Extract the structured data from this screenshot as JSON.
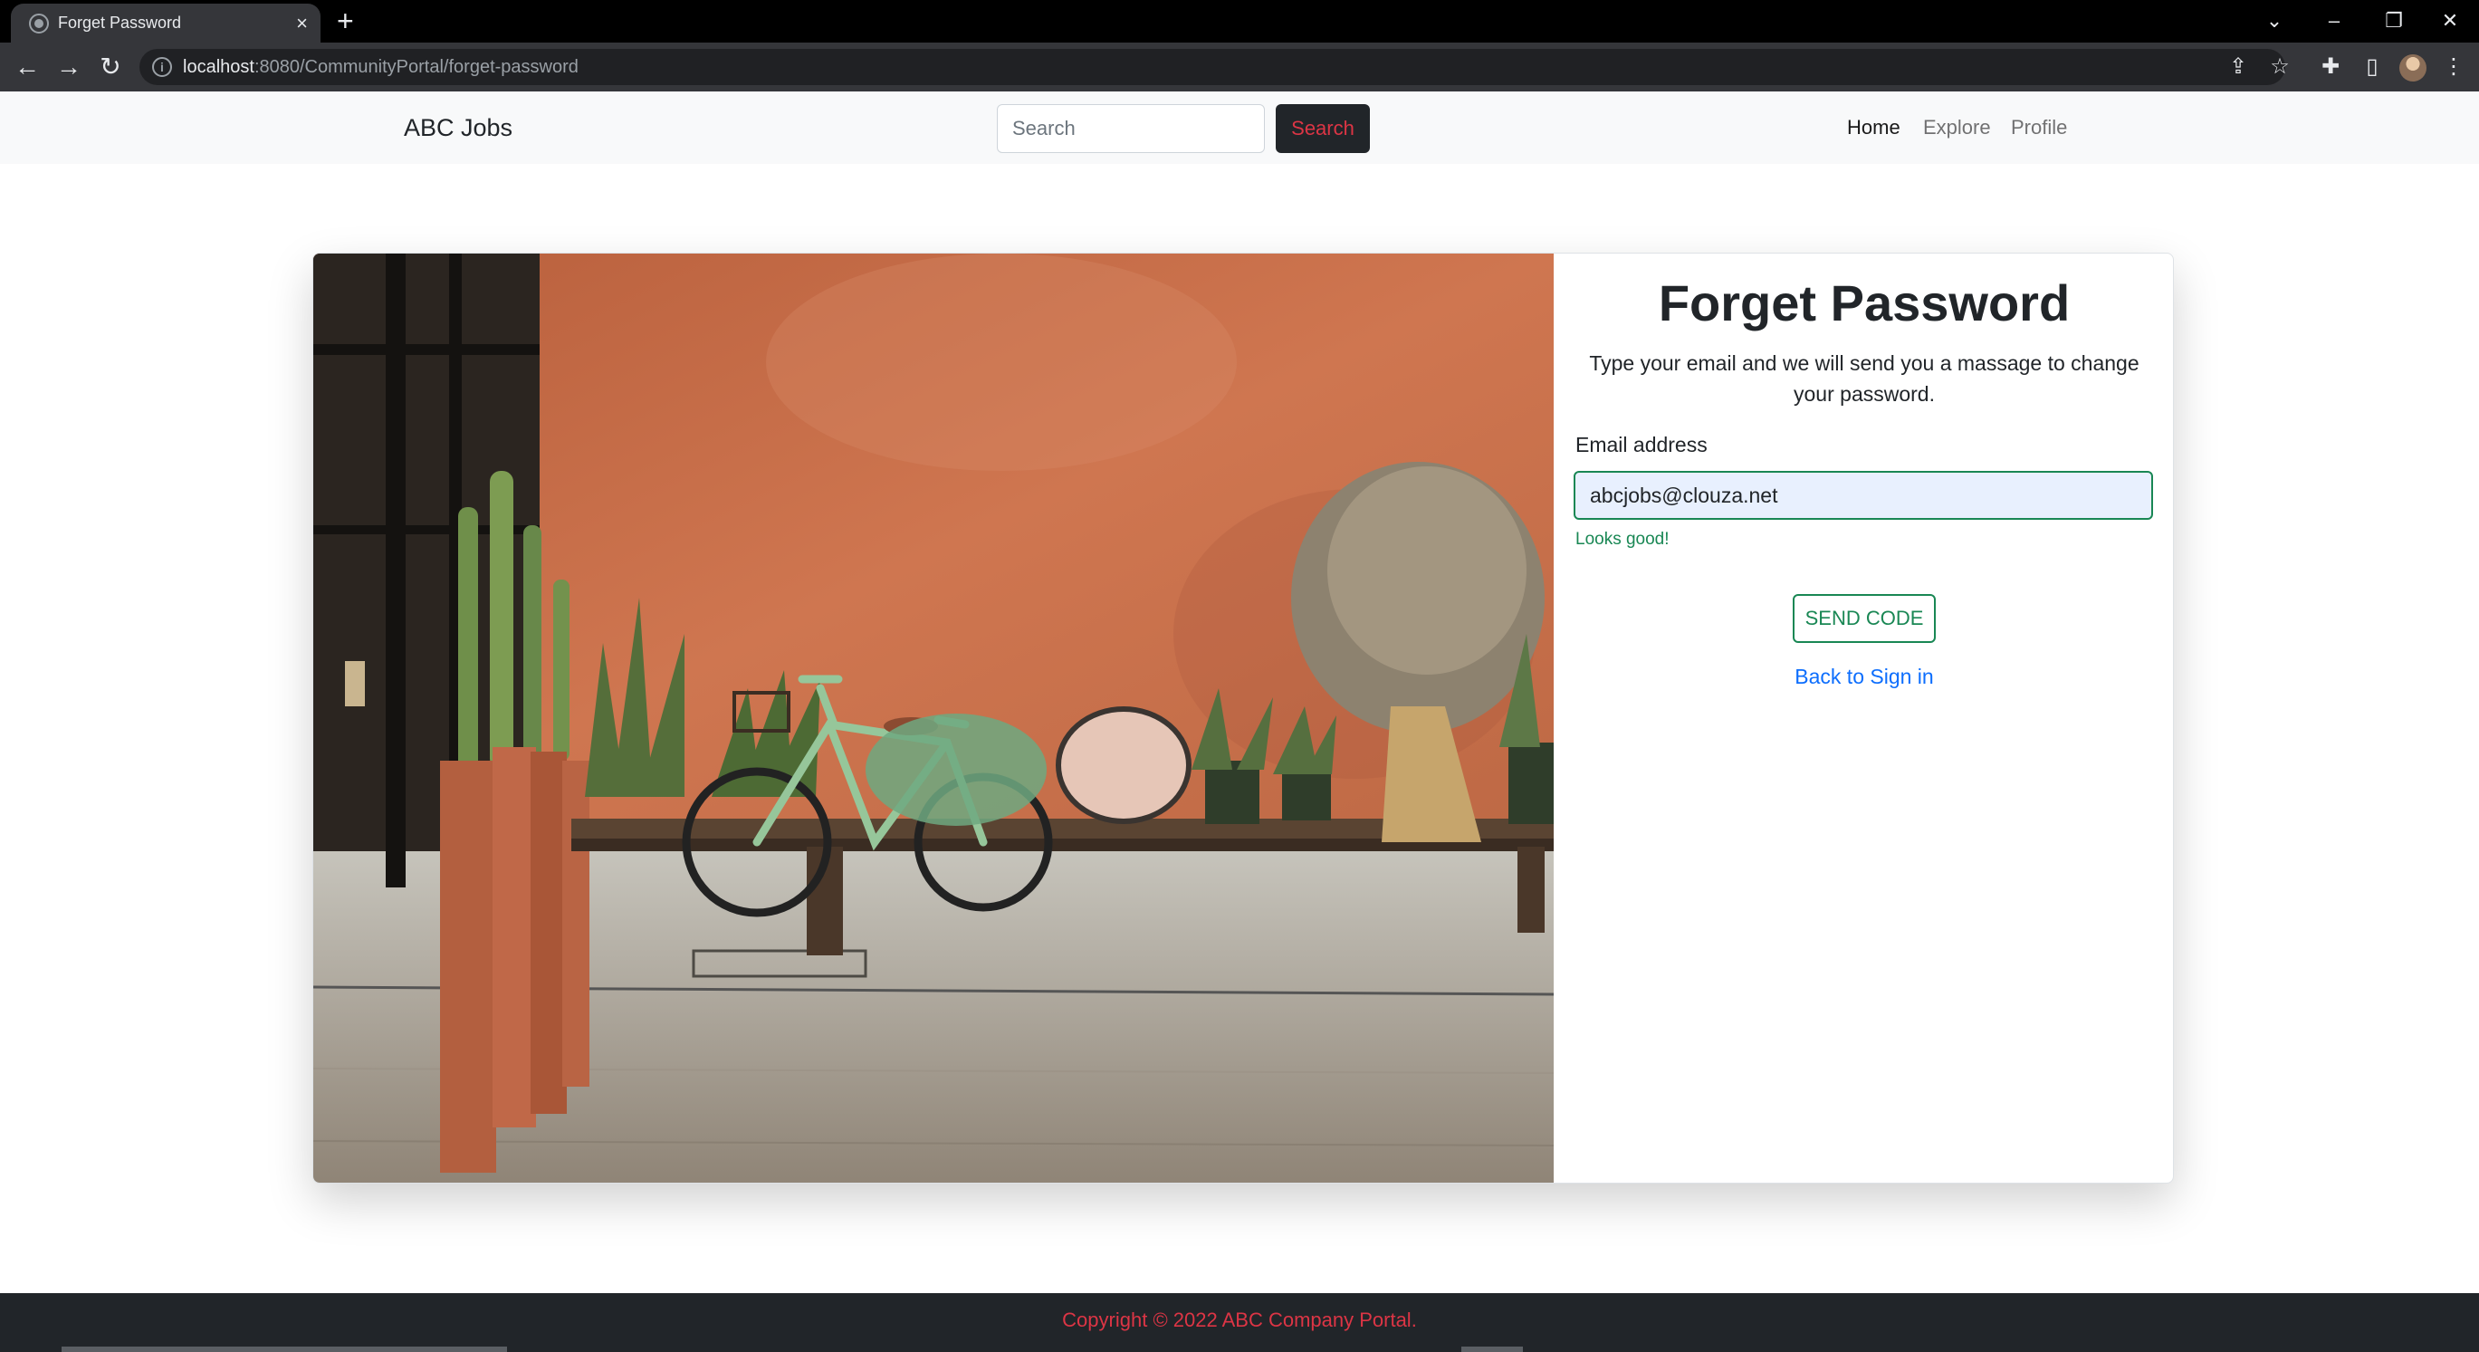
{
  "browser": {
    "tab_title": "Forget Password",
    "tab_close": "×",
    "new_tab": "+",
    "url_host": "localhost",
    "url_path": ":8080/CommunityPortal/forget-password"
  },
  "navbar": {
    "brand": "ABC Jobs",
    "search_placeholder": "Search",
    "search_button": "Search",
    "links": [
      {
        "label": "Home",
        "active": true
      },
      {
        "label": "Explore",
        "active": false
      },
      {
        "label": "Profile",
        "active": false
      }
    ]
  },
  "form": {
    "heading": "Forget Password",
    "subtitle": "Type your email and we will send you a massage to change your password.",
    "email_label": "Email address",
    "email_value": "abcjobs@clouza.net",
    "feedback": "Looks good!",
    "send_button": "SEND CODE",
    "back_link": "Back to Sign in"
  },
  "footer": {
    "text": "Copyright © 2022 ABC Company Portal."
  },
  "colors": {
    "success": "#198754",
    "danger": "#dc3545",
    "link": "#0d6efd",
    "dark": "#212529",
    "wall": "#c8704a"
  },
  "icons": [
    "globe-icon",
    "close-icon",
    "plus-icon",
    "back-icon",
    "forward-icon",
    "reload-icon",
    "info-icon",
    "share-icon",
    "star-icon",
    "extensions-icon",
    "side-panel-icon",
    "kebab-menu-icon",
    "chevron-down-icon",
    "minimize-icon",
    "restore-icon"
  ]
}
